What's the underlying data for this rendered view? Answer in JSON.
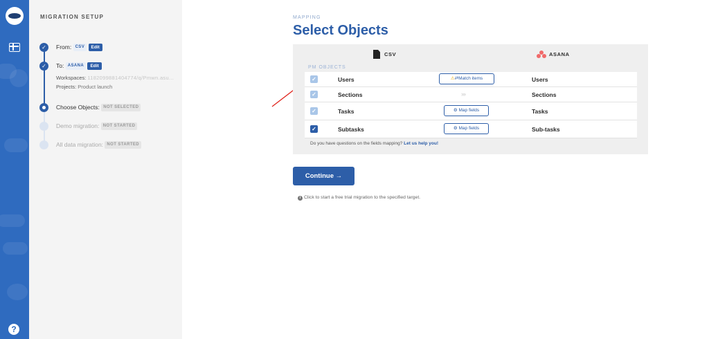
{
  "sidebar": {
    "title": "MIGRATION SETUP",
    "from": {
      "label": "From:",
      "tag": "CSV",
      "edit": "Edit"
    },
    "to": {
      "label": "To:",
      "tag": "ASANA",
      "edit": "Edit",
      "workspaces_label": "Workspaces:",
      "workspaces_value": "1182099881404774/q/Pmwn.asu...",
      "projects_label": "Projects:",
      "projects_value": "Product launch"
    },
    "choose": {
      "label": "Choose Objects:",
      "status": "NOT SELECTED"
    },
    "demo": {
      "label": "Demo migration:",
      "status": "NOT STARTED"
    },
    "all": {
      "label": "All data migration:",
      "status": "NOT STARTED"
    }
  },
  "main": {
    "kicker": "MAPPING",
    "title": "Select Objects",
    "source_name": "CSV",
    "target_name": "ASANA",
    "pm_label": "PM OBJECTS",
    "rows": [
      {
        "source": "Users",
        "target": "Users",
        "action": "Match items",
        "checked": true
      },
      {
        "source": "Sections",
        "target": "Sections",
        "action": "",
        "checked": true
      },
      {
        "source": "Tasks",
        "target": "Tasks",
        "action": "Map fields",
        "checked": true
      },
      {
        "source": "Subtasks",
        "target": "Sub-tasks",
        "action": "Map fields",
        "checked": true
      }
    ],
    "question": "Do you have questions on the fields mapping?",
    "help_link": "Let us help you!",
    "continue": "Continue →",
    "hint": "Click to start a free trial migration to the specified target."
  },
  "colors": {
    "accent": "#2d5ea8",
    "rail": "#2f6bbf",
    "asana": "#f06a6a",
    "annotation": "#e0231b"
  },
  "icons": [
    "app-logo-icon",
    "objects-icon",
    "help-icon",
    "file-icon",
    "asana-icon",
    "warning-icon",
    "swap-icon",
    "gear-icon",
    "info-icon"
  ]
}
